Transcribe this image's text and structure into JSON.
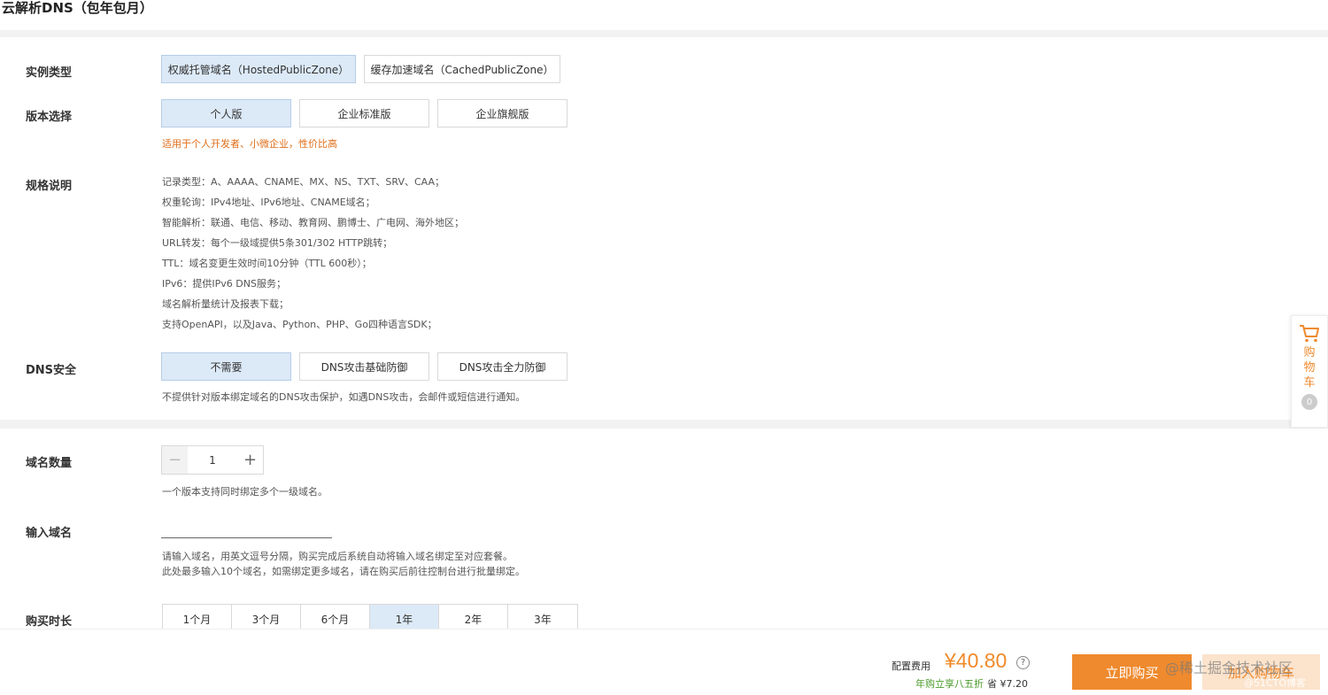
{
  "page_title": "云解析DNS（包年包月）",
  "instance_type": {
    "label": "实例类型",
    "options": [
      "权威托管域名（HostedPublicZone）",
      "缓存加速域名（CachedPublicZone）"
    ],
    "selected": 0
  },
  "edition": {
    "label": "版本选择",
    "options": [
      "个人版",
      "企业标准版",
      "企业旗舰版"
    ],
    "selected": 0,
    "hint": "适用于个人开发者、小微企业，性价比高"
  },
  "spec": {
    "label": "规格说明",
    "items": [
      "记录类型：A、AAAA、CNAME、MX、NS、TXT、SRV、CAA；",
      "权重轮询：IPv4地址、IPv6地址、CNAME域名；",
      "智能解析：联通、电信、移动、教育网、鹏博士、广电网、海外地区；",
      "URL转发：每个一级域提供5条301/302 HTTP跳转；",
      "TTL：域名变更生效时间10分钟（TTL 600秒）；",
      "IPv6：提供IPv6 DNS服务；",
      "域名解析量统计及报表下载；",
      "支持OpenAPI，以及Java、Python、PHP、Go四种语言SDK；"
    ]
  },
  "dns_security": {
    "label": "DNS安全",
    "options": [
      "不需要",
      "DNS攻击基础防御",
      "DNS攻击全力防御"
    ],
    "selected": 0,
    "hint": "不提供针对版本绑定域名的DNS攻击保护，如遇DNS攻击，会邮件或短信进行通知。"
  },
  "domain_count": {
    "label": "域名数量",
    "value": "1",
    "minus": "−",
    "plus": "+",
    "hint": "一个版本支持同时绑定多个一级域名。"
  },
  "domain_input": {
    "label": "输入域名",
    "value": "",
    "hint1": "请输入域名，用英文逗号分隔，购买完成后系统自动将输入域名绑定至对应套餐。",
    "hint2": "此处最多输入10个域名，如需绑定更多域名，请在购买后前往控制台进行批量绑定。"
  },
  "duration": {
    "label": "购买时长",
    "options": [
      "1个月",
      "3个月",
      "6个月",
      "1年",
      "2年",
      "3年"
    ],
    "selected": 3
  },
  "footer": {
    "price_label": "配置费用",
    "price": "¥40.80",
    "help": "?",
    "discount": "年购立享八五折",
    "save": "省 ¥7.20",
    "buy_label": "立即购买",
    "cart_label": "加入购物车",
    "watermark": "@稀土掘金技术社区",
    "watermark2": "@51CTO博客"
  },
  "side_cart": {
    "label": "购物车",
    "count": "0"
  },
  "colors": {
    "accent": "#ef8a2e",
    "selected_bg": "#dce9f7",
    "discount_green": "#4a9a2a"
  }
}
